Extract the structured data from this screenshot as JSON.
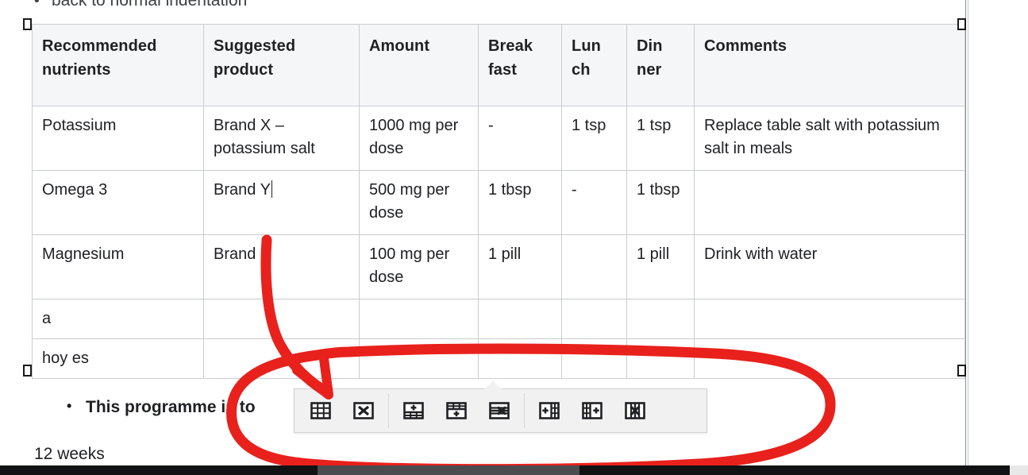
{
  "document": {
    "cut_top_line": "back to normal indentation",
    "below_table_bullet": "This programme is to",
    "weeks_line": "12 weeks",
    "bullet_glyph": "•"
  },
  "table": {
    "headers": [
      "Recommended nutrients",
      "Suggested product",
      "Amount",
      "Break fast",
      "Lun ch",
      "Din ner",
      "Comments"
    ],
    "rows": [
      {
        "nutrient": "Potassium",
        "product": "Brand X – potassium salt",
        "amount": "1000 mg per dose",
        "breakfast": "-",
        "lunch": "1 tsp",
        "dinner": "1 tsp",
        "comments": "Replace table salt with potassium salt in meals"
      },
      {
        "nutrient": "Omega 3",
        "product": "Brand Y",
        "amount": "500 mg per dose",
        "breakfast": "1 tbsp",
        "lunch": "-",
        "dinner": "1 tbsp",
        "comments": ""
      },
      {
        "nutrient": "Magnesium",
        "product": "Brand Z",
        "amount": "100 mg per dose",
        "breakfast": "1 pill",
        "lunch": "",
        "dinner": "1 pill",
        "comments": "Drink with water"
      },
      {
        "nutrient": "a",
        "product": "",
        "amount": "",
        "breakfast": "",
        "lunch": "",
        "dinner": "",
        "comments": ""
      },
      {
        "nutrient": "hoy es",
        "product": "",
        "amount": "",
        "breakfast": "",
        "lunch": "",
        "dinner": "",
        "comments": ""
      }
    ]
  },
  "toolbar": {
    "buttons": [
      {
        "icon": "insert-table-icon",
        "label": "Insert table"
      },
      {
        "icon": "delete-table-icon",
        "label": "Delete table"
      },
      {
        "icon": "insert-row-above-icon",
        "label": "Insert row above"
      },
      {
        "icon": "insert-row-below-icon",
        "label": "Insert row below"
      },
      {
        "icon": "delete-row-icon",
        "label": "Delete row"
      },
      {
        "icon": "insert-column-left-icon",
        "label": "Insert column left"
      },
      {
        "icon": "insert-column-right-icon",
        "label": "Insert column right"
      },
      {
        "icon": "delete-column-icon",
        "label": "Delete column"
      }
    ]
  },
  "annotation": {
    "color": "#e8211c",
    "shapes": [
      "arrow-pointing-to-toolbar",
      "oval-circling-toolbar"
    ]
  },
  "colors": {
    "header_background": "#f5f6f7",
    "table_border": "#c9ccce",
    "toolbar_background": "#f1f1f1",
    "annotation_red": "#e8211c",
    "text": "#202124"
  }
}
